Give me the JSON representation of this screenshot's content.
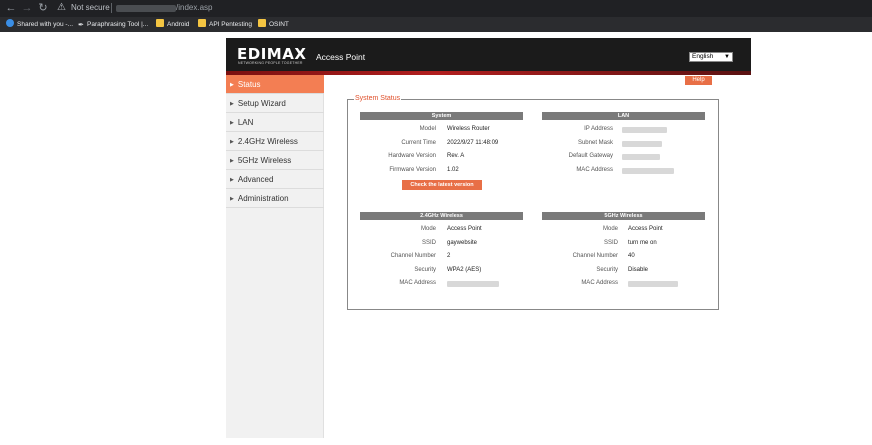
{
  "browser": {
    "security_label": "Not secure",
    "url_path": "/index.asp",
    "bookmarks": [
      {
        "label": "Shared with you -..."
      },
      {
        "label": "Paraphrasing Tool |..."
      },
      {
        "label": "Android"
      },
      {
        "label": "API Pentesting"
      },
      {
        "label": "OSINT"
      }
    ]
  },
  "header": {
    "logo": "EDIMAX",
    "logo_tagline": "NETWORKING PEOPLE TOGETHER",
    "product": "Access Point",
    "language": "English"
  },
  "help_label": "Help",
  "sidebar": {
    "items": [
      {
        "label": "Status"
      },
      {
        "label": "Setup Wizard"
      },
      {
        "label": "LAN"
      },
      {
        "label": "2.4GHz Wireless"
      },
      {
        "label": "5GHz Wireless"
      },
      {
        "label": "Advanced"
      },
      {
        "label": "Administration"
      }
    ]
  },
  "status": {
    "legend": "System Status",
    "system": {
      "title": "System",
      "rows": [
        {
          "label": "Model",
          "value": "Wireless Router"
        },
        {
          "label": "Current Time",
          "value": "2022/9/27  11:48:09"
        },
        {
          "label": "Hardware Version",
          "value": "Rev. A"
        },
        {
          "label": "Firmware Version",
          "value": "1.02"
        }
      ],
      "check_button": "Check the latest version"
    },
    "lan": {
      "title": "LAN",
      "labels": [
        "IP Address",
        "Subnet Mask",
        "Default Gateway",
        "MAC Address"
      ]
    },
    "wireless24": {
      "title": "2.4GHz  Wireless",
      "rows": [
        {
          "label": "Mode",
          "value": "Access Point"
        },
        {
          "label": "SSID",
          "value": "gaywebsite"
        },
        {
          "label": "Channel Number",
          "value": "2"
        },
        {
          "label": "Security",
          "value": "WPA2 (AES)"
        },
        {
          "label": "MAC Address",
          "value": ""
        }
      ]
    },
    "wireless5": {
      "title": "5GHz  Wireless",
      "rows": [
        {
          "label": "Mode",
          "value": "Access Point"
        },
        {
          "label": "SSID",
          "value": "turn me on"
        },
        {
          "label": "Channel Number",
          "value": "40"
        },
        {
          "label": "Security",
          "value": "Disable"
        },
        {
          "label": "MAC Address",
          "value": ""
        }
      ]
    }
  },
  "colors": {
    "accent": "#f37e53",
    "button": "#e86f46",
    "section_header": "#7a7a7a",
    "legend": "#e0502b"
  }
}
